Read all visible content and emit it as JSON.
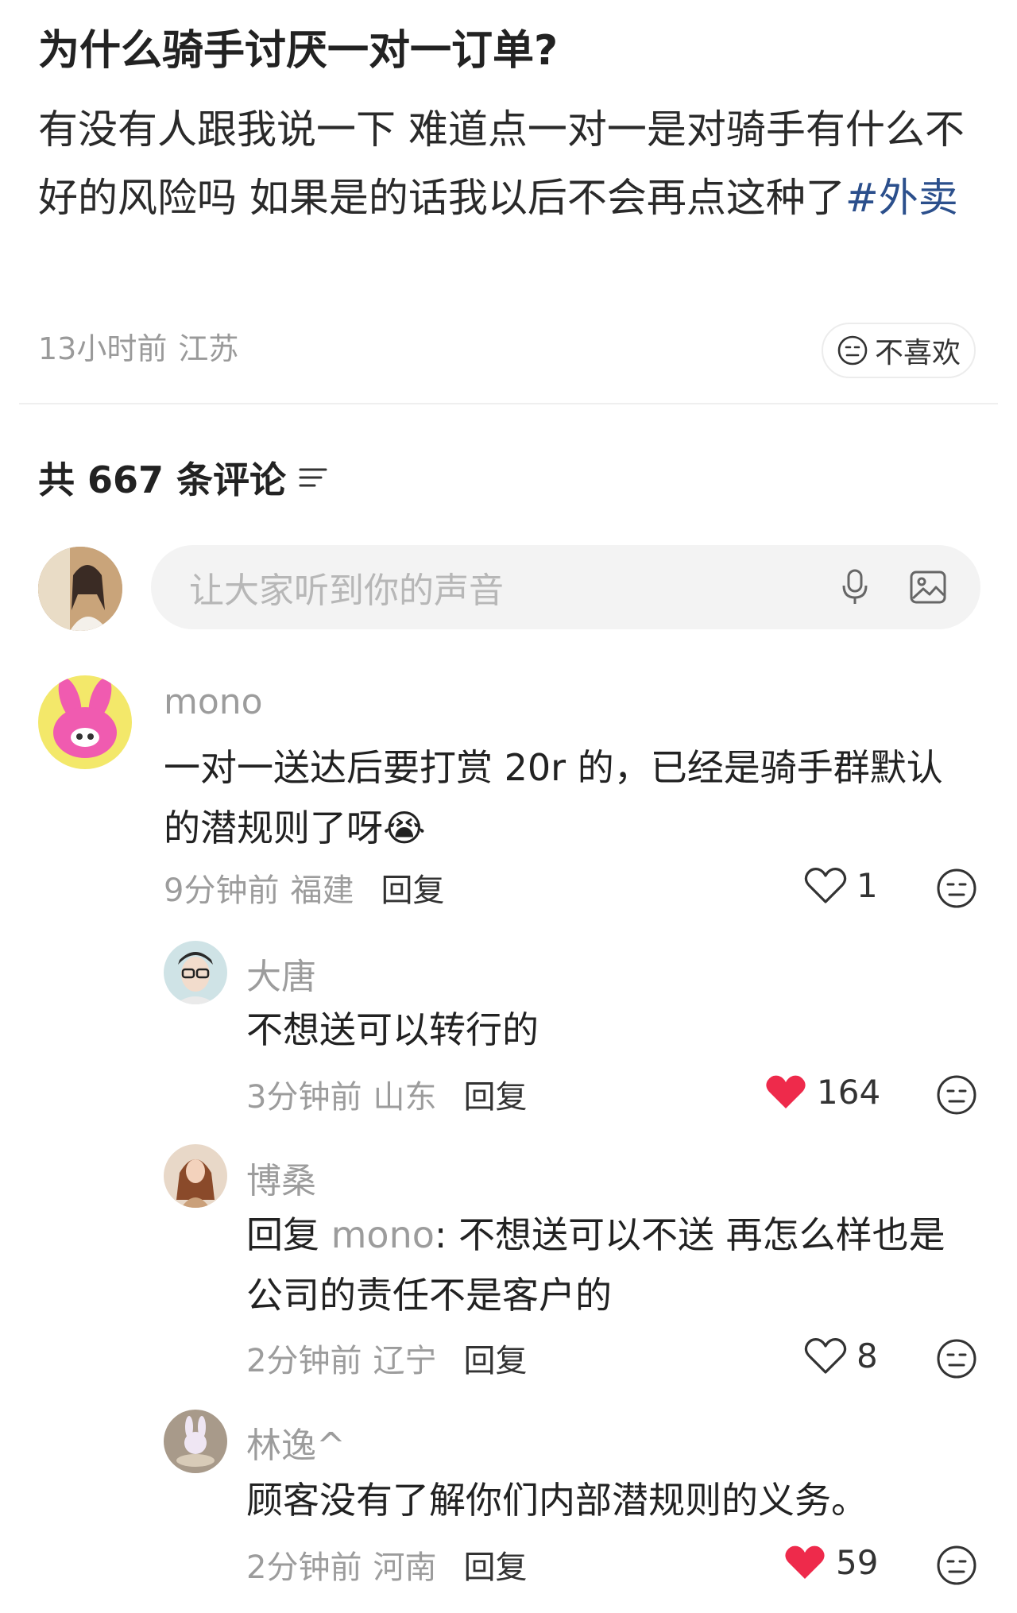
{
  "post": {
    "title": "为什么骑手讨厌一对一订单?",
    "body_text": "有没有人跟我说一下 难道点一对一是对骑手有什么不好的风险吗 如果是的话我以后不会再点这种了",
    "hashtag": "#外卖",
    "time": "13小时前",
    "location": "江苏",
    "dislike_label": "不喜欢"
  },
  "comments_header": {
    "label": "共 667 条评论"
  },
  "comment_input": {
    "placeholder": "让大家听到你的声音"
  },
  "comments": [
    {
      "user": "mono",
      "text": "一对一送达后要打赏 20r 的，已经是骑手群默认的潜规则了呀",
      "emoji": "😭",
      "time": "9分钟前",
      "location": "福建",
      "reply_label": "回复",
      "likes": "1",
      "liked": false
    },
    {
      "user": "大唐",
      "text": "不想送可以转行的",
      "time": "3分钟前",
      "location": "山东",
      "reply_label": "回复",
      "likes": "164",
      "liked": true
    },
    {
      "user": "博桑",
      "reply_prefix": "回复",
      "reply_target": "mono",
      "text": ": 不想送可以不送 再怎么样也是公司的责任不是客户的",
      "time": "2分钟前",
      "location": "辽宁",
      "reply_label": "回复",
      "likes": "8",
      "liked": false
    },
    {
      "user": "林逸^",
      "text": "顾客没有了解你们内部潜规则的义务。",
      "time": "2分钟前",
      "location": "河南",
      "reply_label": "回复",
      "likes": "59",
      "liked": true
    }
  ],
  "colors": {
    "like_red": "#ee2a4b",
    "hashtag": "#2b4f8c",
    "muted": "#9c9c9c"
  }
}
